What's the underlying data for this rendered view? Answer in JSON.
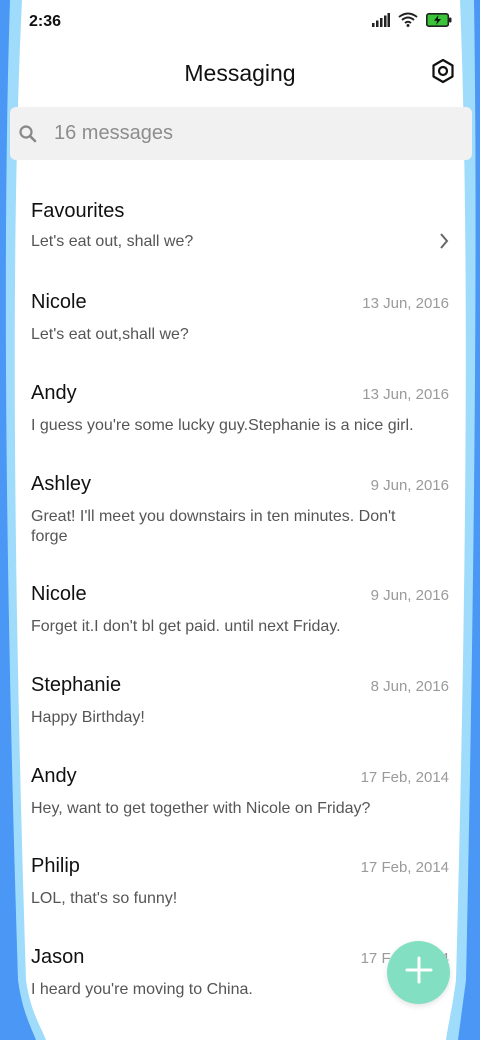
{
  "status": {
    "time": "2:36"
  },
  "header": {
    "title": "Messaging",
    "settings_icon": "gear-icon"
  },
  "search": {
    "placeholder": "16 messages",
    "icon": "search-icon"
  },
  "conversations": [
    {
      "name": "Favourites",
      "date": "",
      "message": "Let's eat out, shall we?"
    },
    {
      "name": "Nicole",
      "date": "13 Jun, 2016",
      "message": "Let's eat out,shall we?"
    },
    {
      "name": "Andy",
      "date": "13 Jun, 2016",
      "message": "I guess you're some lucky guy.Stephanie is a nice girl."
    },
    {
      "name": "Ashley",
      "date": "9 Jun, 2016",
      "message": "Great! I'll meet you downstairs in ten minutes. Don't forge"
    },
    {
      "name": "Nicole",
      "date": "9 Jun, 2016",
      "message": "Forget it.I don't bl get paid. until next Friday."
    },
    {
      "name": "Stephanie",
      "date": "8 Jun, 2016",
      "message": "Happy Birthday!"
    },
    {
      "name": "Andy",
      "date": "17 Feb, 2014",
      "message": "Hey, want to get together with Nicole on Friday?"
    },
    {
      "name": "Philip",
      "date": "17 Feb, 2014",
      "message": "LOL, that's so funny!"
    },
    {
      "name": "Jason",
      "date": "17 Feb, 2014",
      "message": "I heard you're moving to China."
    }
  ],
  "fab": {
    "icon": "plus-icon",
    "color": "#82dfc1"
  },
  "colors": {
    "edge_dark": "#4a97f5",
    "edge_light": "#9fdcfb"
  }
}
